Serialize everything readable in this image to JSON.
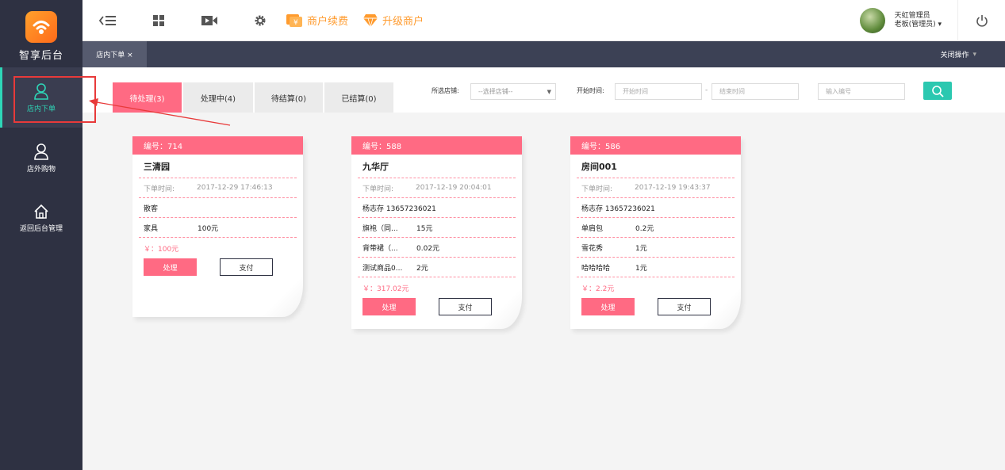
{
  "sidebar": {
    "logo_text": "智享后台",
    "items": [
      {
        "label": "店内下单",
        "icon": "user-icon",
        "active": true
      },
      {
        "label": "店外购物",
        "icon": "user-icon",
        "active": false
      },
      {
        "label": "返回后台管理",
        "icon": "home-icon",
        "active": false
      }
    ]
  },
  "header": {
    "merchant_renew_label": "商户续费",
    "upgrade_label": "升级商户",
    "user_name": "天虹管理员",
    "user_role": "老板(管理员)",
    "accent_color": "#ff9b2e"
  },
  "tabbar": {
    "tab_label": "店内下单 ×",
    "close_ops_label": "关闭操作"
  },
  "filters": {
    "status_tabs": [
      "待处理(3)",
      "处理中(4)",
      "待结算(0)",
      "已结算(0)"
    ],
    "store_label": "所选店铺:",
    "store_select": "--选择店铺--",
    "start_time_label": "开始时间:",
    "start_placeholder": "开始时间",
    "dash": "-",
    "end_placeholder": "结束时间",
    "number_placeholder": "输入编号"
  },
  "orders": [
    {
      "number": "编号：714",
      "title": "三清园",
      "time_label": "下单时间:",
      "time": "2017-12-29 17:46:13",
      "customer": "散客",
      "items": [
        {
          "name": "家具",
          "price": "100元"
        }
      ],
      "total": "￥：100元",
      "process_label": "处理",
      "pay_label": "支付"
    },
    {
      "number": "编号：588",
      "title": "九华厅",
      "time_label": "下单时间:",
      "time": "2017-12-19 20:04:01",
      "customer": "杨志存  13657236021",
      "items": [
        {
          "name": "旗袍（同...",
          "price": "15元"
        },
        {
          "name": "背带裙（...",
          "price": "0.02元"
        },
        {
          "name": "测试商品0...",
          "price": "2元"
        }
      ],
      "total": "￥：317.02元",
      "process_label": "处理",
      "pay_label": "支付"
    },
    {
      "number": "编号：586",
      "title": "房间001",
      "time_label": "下单时间:",
      "time": "2017-12-19 19:43:37",
      "customer": "杨志存  13657236021",
      "items": [
        {
          "name": "单肩包",
          "price": "0.2元"
        },
        {
          "name": "雪花秀",
          "price": "1元"
        },
        {
          "name": "哈哈哈哈",
          "price": "1元"
        }
      ],
      "total": "￥：2.2元",
      "process_label": "处理",
      "pay_label": "支付"
    }
  ],
  "colors": {
    "sidebar_bg": "#2e3142",
    "active_accent": "#2ed6b7",
    "card_accent": "#ff6a83",
    "search_button": "#2bc8b0"
  }
}
